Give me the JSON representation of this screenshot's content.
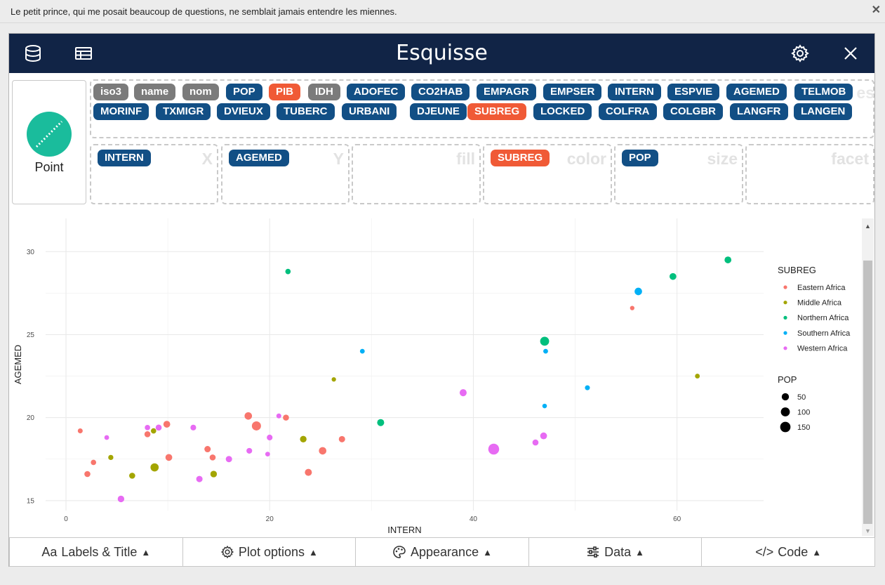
{
  "notification": {
    "message": "Le petit prince, qui me posait beaucoup de questions, ne semblait jamais entendre les miennes.",
    "close": "✕"
  },
  "header": {
    "title": "Esquisse",
    "icons": [
      "database-icon",
      "table-icon",
      "gear-icon",
      "close-icon"
    ]
  },
  "geom": {
    "label": "Point",
    "color": "#1abc9c"
  },
  "variables": [
    {
      "name": "iso3",
      "kind": "grey"
    },
    {
      "name": "name",
      "kind": "grey"
    },
    {
      "name": "nom",
      "kind": "grey"
    },
    {
      "name": "POP",
      "kind": "blue"
    },
    {
      "name": "PIB",
      "kind": "orange"
    },
    {
      "name": "IDH",
      "kind": "grey"
    },
    {
      "name": "ADOFEC",
      "kind": "blue"
    },
    {
      "name": "CO2HAB",
      "kind": "blue"
    },
    {
      "name": "EMPAGR",
      "kind": "blue"
    },
    {
      "name": "EMPSER",
      "kind": "blue"
    },
    {
      "name": "INTERN",
      "kind": "blue"
    },
    {
      "name": "ESPVIE",
      "kind": "blue"
    },
    {
      "name": "AGEMED",
      "kind": "blue"
    },
    {
      "name": "TELMOB",
      "kind": "blue"
    },
    {
      "name": "MORINF",
      "kind": "blue"
    },
    {
      "name": "TXMIGR",
      "kind": "blue"
    },
    {
      "name": "DVIEUX",
      "kind": "blue"
    },
    {
      "name": "TUBERC",
      "kind": "blue"
    },
    {
      "name": "URBANI",
      "kind": "blue"
    },
    {
      "name": "DJEUNE",
      "kind": "blue"
    },
    {
      "name": "SUBREG",
      "kind": "orange"
    },
    {
      "name": "LOCKED",
      "kind": "blue"
    },
    {
      "name": "COLFRA",
      "kind": "blue"
    },
    {
      "name": "COLGBR",
      "kind": "blue"
    },
    {
      "name": "LANGFR",
      "kind": "blue"
    },
    {
      "name": "LANGEN",
      "kind": "blue"
    }
  ],
  "var_pool_label": "es",
  "zones": [
    {
      "label": "X",
      "value": "INTERN",
      "kind": "blue"
    },
    {
      "label": "Y",
      "value": "AGEMED",
      "kind": "blue"
    },
    {
      "label": "fill",
      "value": "",
      "kind": ""
    },
    {
      "label": "color",
      "value": "SUBREG",
      "kind": "orange"
    },
    {
      "label": "size",
      "value": "POP",
      "kind": "blue"
    },
    {
      "label": "facet",
      "value": "",
      "kind": ""
    }
  ],
  "bottom_bar": [
    {
      "label": "Labels & Title",
      "icon": "Aa"
    },
    {
      "label": "Plot options",
      "icon": "gear-icon"
    },
    {
      "label": "Appearance",
      "icon": "palette-icon"
    },
    {
      "label": "Data",
      "icon": "sliders-icon"
    },
    {
      "label": "Code",
      "icon": "</>"
    }
  ],
  "colors": {
    "Eastern Africa": "#f8766d",
    "Middle Africa": "#a3a500",
    "Northern Africa": "#00bf7d",
    "Southern Africa": "#00b0f6",
    "Western Africa": "#e76bf3"
  },
  "chart_data": {
    "type": "scatter",
    "xlabel": "INTERN",
    "ylabel": "AGEMED",
    "xlim": [
      -2,
      68.5
    ],
    "ylim": [
      14.4,
      32
    ],
    "x_ticks": [
      0,
      20,
      40,
      60
    ],
    "y_ticks": [
      15,
      20,
      25,
      30
    ],
    "grid": true,
    "legend": {
      "position": "right",
      "color_title": "SUBREG",
      "color_entries": [
        "Eastern Africa",
        "Middle Africa",
        "Northern Africa",
        "Southern Africa",
        "Western Africa"
      ],
      "size_title": "POP",
      "size_entries": [
        50,
        100,
        150
      ]
    },
    "points": [
      {
        "x": 1.4,
        "y": 19.2,
        "group": "Eastern Africa",
        "pop": 10
      },
      {
        "x": 2.1,
        "y": 16.6,
        "group": "Eastern Africa",
        "pop": 25
      },
      {
        "x": 2.7,
        "y": 17.3,
        "group": "Eastern Africa",
        "pop": 15
      },
      {
        "x": 8.0,
        "y": 19.0,
        "group": "Eastern Africa",
        "pop": 25
      },
      {
        "x": 9.9,
        "y": 19.6,
        "group": "Eastern Africa",
        "pop": 40
      },
      {
        "x": 10.1,
        "y": 17.6,
        "group": "Eastern Africa",
        "pop": 40
      },
      {
        "x": 13.9,
        "y": 18.1,
        "group": "Eastern Africa",
        "pop": 30
      },
      {
        "x": 14.4,
        "y": 17.6,
        "group": "Eastern Africa",
        "pop": 25
      },
      {
        "x": 17.9,
        "y": 20.1,
        "group": "Eastern Africa",
        "pop": 55
      },
      {
        "x": 18.7,
        "y": 19.5,
        "group": "Eastern Africa",
        "pop": 105
      },
      {
        "x": 21.6,
        "y": 20.0,
        "group": "Eastern Africa",
        "pop": 25
      },
      {
        "x": 23.8,
        "y": 16.7,
        "group": "Eastern Africa",
        "pop": 45
      },
      {
        "x": 25.2,
        "y": 18.0,
        "group": "Eastern Africa",
        "pop": 55
      },
      {
        "x": 27.1,
        "y": 18.7,
        "group": "Eastern Africa",
        "pop": 30
      },
      {
        "x": 55.6,
        "y": 26.6,
        "group": "Eastern Africa",
        "pop": 5
      },
      {
        "x": 4.4,
        "y": 17.6,
        "group": "Middle Africa",
        "pop": 12
      },
      {
        "x": 6.5,
        "y": 16.5,
        "group": "Middle Africa",
        "pop": 25
      },
      {
        "x": 8.6,
        "y": 19.2,
        "group": "Middle Africa",
        "pop": 15
      },
      {
        "x": 8.7,
        "y": 17.0,
        "group": "Middle Africa",
        "pop": 75
      },
      {
        "x": 14.5,
        "y": 16.6,
        "group": "Middle Africa",
        "pop": 35
      },
      {
        "x": 23.3,
        "y": 18.7,
        "group": "Middle Africa",
        "pop": 35
      },
      {
        "x": 26.3,
        "y": 22.3,
        "group": "Middle Africa",
        "pop": 5
      },
      {
        "x": 62.0,
        "y": 22.5,
        "group": "Middle Africa",
        "pop": 8
      },
      {
        "x": 21.8,
        "y": 28.8,
        "group": "Northern Africa",
        "pop": 15
      },
      {
        "x": 30.9,
        "y": 19.7,
        "group": "Northern Africa",
        "pop": 45
      },
      {
        "x": 47.0,
        "y": 24.6,
        "group": "Northern Africa",
        "pop": 100
      },
      {
        "x": 59.6,
        "y": 28.5,
        "group": "Northern Africa",
        "pop": 40
      },
      {
        "x": 65.0,
        "y": 29.5,
        "group": "Northern Africa",
        "pop": 40
      },
      {
        "x": 29.1,
        "y": 24.0,
        "group": "Southern Africa",
        "pop": 8
      },
      {
        "x": 47.1,
        "y": 24.0,
        "group": "Southern Africa",
        "pop": 8
      },
      {
        "x": 47.0,
        "y": 20.7,
        "group": "Southern Africa",
        "pop": 6
      },
      {
        "x": 51.2,
        "y": 21.8,
        "group": "Southern Africa",
        "pop": 10
      },
      {
        "x": 56.2,
        "y": 27.6,
        "group": "Southern Africa",
        "pop": 55
      },
      {
        "x": 4.0,
        "y": 18.8,
        "group": "Western Africa",
        "pop": 8
      },
      {
        "x": 8.0,
        "y": 19.4,
        "group": "Western Africa",
        "pop": 15
      },
      {
        "x": 9.1,
        "y": 19.4,
        "group": "Western Africa",
        "pop": 25
      },
      {
        "x": 12.5,
        "y": 19.4,
        "group": "Western Africa",
        "pop": 20
      },
      {
        "x": 13.1,
        "y": 16.3,
        "group": "Western Africa",
        "pop": 30
      },
      {
        "x": 16.0,
        "y": 17.5,
        "group": "Western Africa",
        "pop": 30
      },
      {
        "x": 18.0,
        "y": 18.0,
        "group": "Western Africa",
        "pop": 20
      },
      {
        "x": 19.8,
        "y": 17.8,
        "group": "Western Africa",
        "pop": 8
      },
      {
        "x": 20.0,
        "y": 18.8,
        "group": "Western Africa",
        "pop": 20
      },
      {
        "x": 20.9,
        "y": 20.1,
        "group": "Western Africa",
        "pop": 10
      },
      {
        "x": 5.4,
        "y": 15.1,
        "group": "Western Africa",
        "pop": 35
      },
      {
        "x": 39.0,
        "y": 21.5,
        "group": "Western Africa",
        "pop": 45
      },
      {
        "x": 42.0,
        "y": 18.1,
        "group": "Western Africa",
        "pop": 175
      },
      {
        "x": 46.1,
        "y": 18.5,
        "group": "Western Africa",
        "pop": 25
      },
      {
        "x": 46.9,
        "y": 18.9,
        "group": "Western Africa",
        "pop": 40
      }
    ]
  }
}
